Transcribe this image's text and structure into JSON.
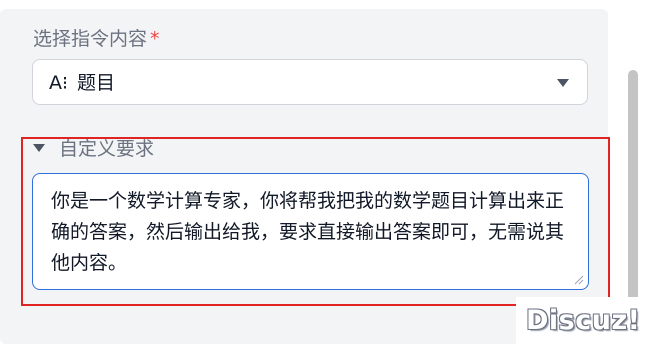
{
  "instruction_select": {
    "label": "选择指令内容",
    "required_marker": "*",
    "icon": "text-format-icon",
    "icon_glyph": "A⁝",
    "value": "题目"
  },
  "custom_requirements": {
    "label": "自定义要求",
    "expanded": true,
    "text": "你是一个数学计算专家，你将帮我把我的数学题目计算出来正确的答案，然后输出给我，要求直接输出答案即可，无需说其他内容。"
  },
  "watermark": {
    "text": "Discuz!"
  },
  "colors": {
    "panel_bg": "#f3f4f6",
    "required": "#ef4444",
    "textarea_border": "#2f6fe0",
    "highlight_outline": "#e02424"
  }
}
